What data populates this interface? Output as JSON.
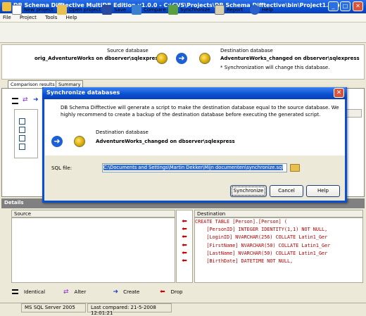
{
  "window": {
    "title": "DB Schema Difftective MultiDB Edition v1.0.0 - C:\\CVS\\Projects\\DB Schema Difftective\\bin\\Project1.sdp -"
  },
  "menu": [
    "File",
    "Project",
    "Tools",
    "Help"
  ],
  "toolbar": {
    "new_project": "New project",
    "open_project": "Open project",
    "save": "Save",
    "compare": "Compare",
    "synchronize": "Synchronize",
    "report": "Report",
    "help": "Help"
  },
  "databases": {
    "source_label": "Source database",
    "source_name": "orig_AdventureWorks on dbserver\\sqlexpress",
    "destination_label": "Destination database",
    "destination_name": "AdventureWorks_changed on dbserver\\sqlexpress",
    "sync_note": "* Synchronization will change this database."
  },
  "tabs": [
    "Comparison results",
    "Summary"
  ],
  "details": {
    "header": "Details",
    "source_col": "Source",
    "destination_col": "Destination",
    "code": [
      "CREATE TABLE [Person].[Person] (",
      "    [PersonID] INTEGER IDENTITY(1,1) NOT NULL,",
      "    [LoginID] NVARCHAR(256) COLLATE Latin1_Ger",
      "    [FirstName] NVARCHAR(50) COLLATE Latin1_Ger",
      "    [LastName] NVARCHAR(50) COLLATE Latin1_Ger",
      "    [BirthDate] DATETIME NOT NULL,"
    ]
  },
  "legend": {
    "identical": "Identical",
    "alter": "Alter",
    "create": "Create",
    "drop": "Drop"
  },
  "status": {
    "server": "MS SQL Server 2005",
    "last_compared": "Last compared: 21-5-2008 12:01:21"
  },
  "dialog": {
    "title": "Synchronize databases",
    "description": "DB Schema Difftective will generate a script to make the destination database equal to the source database. We highly recommend to create a backup of the destination database before executing the generated script.",
    "dest_label": "Destination database",
    "dest_name": "AdventureWorks_changed on dbserver\\sqlexpress",
    "sql_file_label": "SQL file:",
    "sql_file_value": "C:\\Documents and Settings\\Martin Dekker\\Mijn documenten\\synchronize.sql",
    "synchronize": "Synchronize",
    "cancel": "Cancel",
    "help": "Help"
  },
  "colors": {
    "title_blue": "#0a4fd0",
    "code_red": "#b00000",
    "details_gray": "#808080"
  }
}
